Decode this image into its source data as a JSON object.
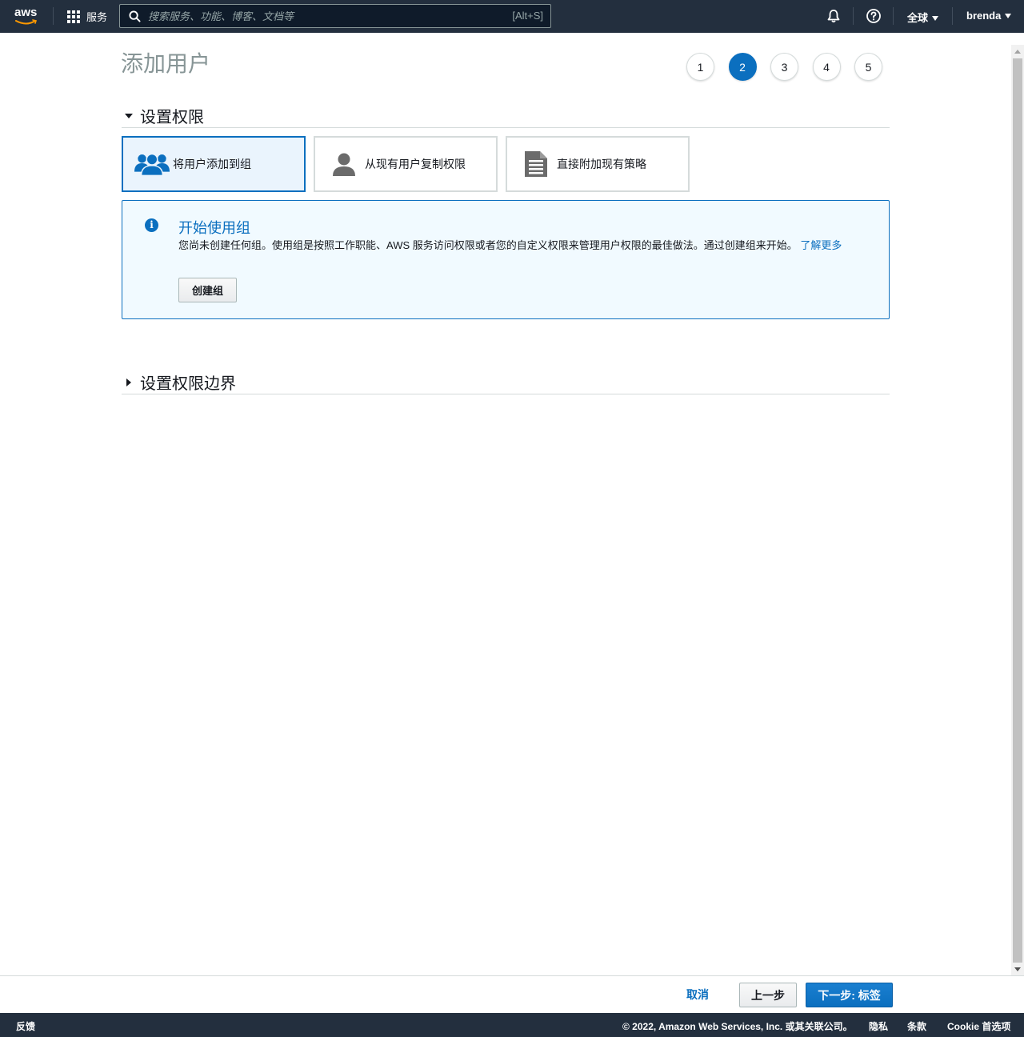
{
  "topnav": {
    "logo_text": "aws",
    "services_label": "服务",
    "search_placeholder": "搜索服务、功能、博客、文档等",
    "search_shortcut": "[Alt+S]",
    "region_label": "全球",
    "user_label": "brenda"
  },
  "page": {
    "title": "添加用户",
    "steps": [
      "1",
      "2",
      "3",
      "4",
      "5"
    ],
    "active_step": "2"
  },
  "permissions": {
    "section_title": "设置权限",
    "options": [
      {
        "label": "将用户添加到组",
        "icon": "users-group-icon",
        "selected": true
      },
      {
        "label": "从现有用户复制权限",
        "icon": "user-icon",
        "selected": false
      },
      {
        "label": "直接附加现有策略",
        "icon": "document-icon",
        "selected": false
      }
    ],
    "info": {
      "title": "开始使用组",
      "text": "您尚未创建任何组。使用组是按照工作职能、AWS 服务访问权限或者您的自定义权限来管理用户权限的最佳做法。通过创建组来开始。",
      "link": "了解更多",
      "button": "创建组"
    }
  },
  "boundary": {
    "section_title": "设置权限边界"
  },
  "actions": {
    "cancel": "取消",
    "previous": "上一步",
    "next": "下一步: 标签"
  },
  "footer": {
    "feedback": "反馈",
    "copyright": "© 2022, Amazon Web Services, Inc. 或其关联公司。",
    "privacy": "隐私",
    "terms": "条款",
    "cookie": "Cookie 首选项"
  },
  "colors": {
    "nav_bg": "#232f3e",
    "accent": "#0b6fbf",
    "selected_bg": "#eaf4fd",
    "info_bg": "#f1faff",
    "aws_orange": "#ff9900"
  }
}
